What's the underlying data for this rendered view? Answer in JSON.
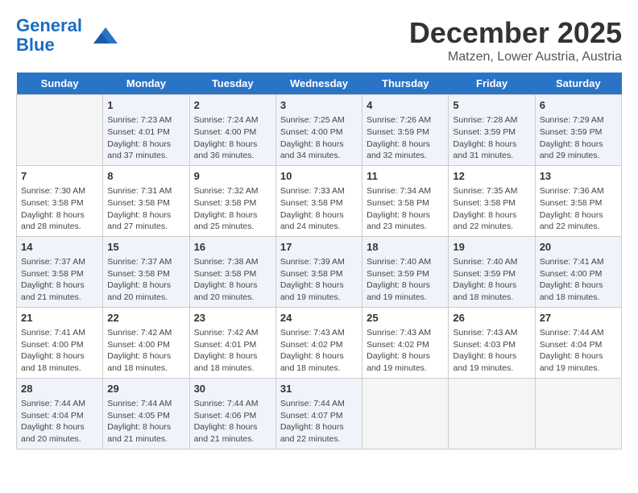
{
  "logo": {
    "line1": "General",
    "line2": "Blue"
  },
  "title": "December 2025",
  "location": "Matzen, Lower Austria, Austria",
  "days_of_week": [
    "Sunday",
    "Monday",
    "Tuesday",
    "Wednesday",
    "Thursday",
    "Friday",
    "Saturday"
  ],
  "weeks": [
    [
      {
        "day": "",
        "sunrise": "",
        "sunset": "",
        "daylight": "",
        "empty": true
      },
      {
        "day": "1",
        "sunrise": "Sunrise: 7:23 AM",
        "sunset": "Sunset: 4:01 PM",
        "daylight": "Daylight: 8 hours and 37 minutes."
      },
      {
        "day": "2",
        "sunrise": "Sunrise: 7:24 AM",
        "sunset": "Sunset: 4:00 PM",
        "daylight": "Daylight: 8 hours and 36 minutes."
      },
      {
        "day": "3",
        "sunrise": "Sunrise: 7:25 AM",
        "sunset": "Sunset: 4:00 PM",
        "daylight": "Daylight: 8 hours and 34 minutes."
      },
      {
        "day": "4",
        "sunrise": "Sunrise: 7:26 AM",
        "sunset": "Sunset: 3:59 PM",
        "daylight": "Daylight: 8 hours and 32 minutes."
      },
      {
        "day": "5",
        "sunrise": "Sunrise: 7:28 AM",
        "sunset": "Sunset: 3:59 PM",
        "daylight": "Daylight: 8 hours and 31 minutes."
      },
      {
        "day": "6",
        "sunrise": "Sunrise: 7:29 AM",
        "sunset": "Sunset: 3:59 PM",
        "daylight": "Daylight: 8 hours and 29 minutes."
      }
    ],
    [
      {
        "day": "7",
        "sunrise": "Sunrise: 7:30 AM",
        "sunset": "Sunset: 3:58 PM",
        "daylight": "Daylight: 8 hours and 28 minutes."
      },
      {
        "day": "8",
        "sunrise": "Sunrise: 7:31 AM",
        "sunset": "Sunset: 3:58 PM",
        "daylight": "Daylight: 8 hours and 27 minutes."
      },
      {
        "day": "9",
        "sunrise": "Sunrise: 7:32 AM",
        "sunset": "Sunset: 3:58 PM",
        "daylight": "Daylight: 8 hours and 25 minutes."
      },
      {
        "day": "10",
        "sunrise": "Sunrise: 7:33 AM",
        "sunset": "Sunset: 3:58 PM",
        "daylight": "Daylight: 8 hours and 24 minutes."
      },
      {
        "day": "11",
        "sunrise": "Sunrise: 7:34 AM",
        "sunset": "Sunset: 3:58 PM",
        "daylight": "Daylight: 8 hours and 23 minutes."
      },
      {
        "day": "12",
        "sunrise": "Sunrise: 7:35 AM",
        "sunset": "Sunset: 3:58 PM",
        "daylight": "Daylight: 8 hours and 22 minutes."
      },
      {
        "day": "13",
        "sunrise": "Sunrise: 7:36 AM",
        "sunset": "Sunset: 3:58 PM",
        "daylight": "Daylight: 8 hours and 22 minutes."
      }
    ],
    [
      {
        "day": "14",
        "sunrise": "Sunrise: 7:37 AM",
        "sunset": "Sunset: 3:58 PM",
        "daylight": "Daylight: 8 hours and 21 minutes."
      },
      {
        "day": "15",
        "sunrise": "Sunrise: 7:37 AM",
        "sunset": "Sunset: 3:58 PM",
        "daylight": "Daylight: 8 hours and 20 minutes."
      },
      {
        "day": "16",
        "sunrise": "Sunrise: 7:38 AM",
        "sunset": "Sunset: 3:58 PM",
        "daylight": "Daylight: 8 hours and 20 minutes."
      },
      {
        "day": "17",
        "sunrise": "Sunrise: 7:39 AM",
        "sunset": "Sunset: 3:58 PM",
        "daylight": "Daylight: 8 hours and 19 minutes."
      },
      {
        "day": "18",
        "sunrise": "Sunrise: 7:40 AM",
        "sunset": "Sunset: 3:59 PM",
        "daylight": "Daylight: 8 hours and 19 minutes."
      },
      {
        "day": "19",
        "sunrise": "Sunrise: 7:40 AM",
        "sunset": "Sunset: 3:59 PM",
        "daylight": "Daylight: 8 hours and 18 minutes."
      },
      {
        "day": "20",
        "sunrise": "Sunrise: 7:41 AM",
        "sunset": "Sunset: 4:00 PM",
        "daylight": "Daylight: 8 hours and 18 minutes."
      }
    ],
    [
      {
        "day": "21",
        "sunrise": "Sunrise: 7:41 AM",
        "sunset": "Sunset: 4:00 PM",
        "daylight": "Daylight: 8 hours and 18 minutes."
      },
      {
        "day": "22",
        "sunrise": "Sunrise: 7:42 AM",
        "sunset": "Sunset: 4:00 PM",
        "daylight": "Daylight: 8 hours and 18 minutes."
      },
      {
        "day": "23",
        "sunrise": "Sunrise: 7:42 AM",
        "sunset": "Sunset: 4:01 PM",
        "daylight": "Daylight: 8 hours and 18 minutes."
      },
      {
        "day": "24",
        "sunrise": "Sunrise: 7:43 AM",
        "sunset": "Sunset: 4:02 PM",
        "daylight": "Daylight: 8 hours and 18 minutes."
      },
      {
        "day": "25",
        "sunrise": "Sunrise: 7:43 AM",
        "sunset": "Sunset: 4:02 PM",
        "daylight": "Daylight: 8 hours and 19 minutes."
      },
      {
        "day": "26",
        "sunrise": "Sunrise: 7:43 AM",
        "sunset": "Sunset: 4:03 PM",
        "daylight": "Daylight: 8 hours and 19 minutes."
      },
      {
        "day": "27",
        "sunrise": "Sunrise: 7:44 AM",
        "sunset": "Sunset: 4:04 PM",
        "daylight": "Daylight: 8 hours and 19 minutes."
      }
    ],
    [
      {
        "day": "28",
        "sunrise": "Sunrise: 7:44 AM",
        "sunset": "Sunset: 4:04 PM",
        "daylight": "Daylight: 8 hours and 20 minutes."
      },
      {
        "day": "29",
        "sunrise": "Sunrise: 7:44 AM",
        "sunset": "Sunset: 4:05 PM",
        "daylight": "Daylight: 8 hours and 21 minutes."
      },
      {
        "day": "30",
        "sunrise": "Sunrise: 7:44 AM",
        "sunset": "Sunset: 4:06 PM",
        "daylight": "Daylight: 8 hours and 21 minutes."
      },
      {
        "day": "31",
        "sunrise": "Sunrise: 7:44 AM",
        "sunset": "Sunset: 4:07 PM",
        "daylight": "Daylight: 8 hours and 22 minutes."
      },
      {
        "day": "",
        "sunrise": "",
        "sunset": "",
        "daylight": "",
        "empty": true
      },
      {
        "day": "",
        "sunrise": "",
        "sunset": "",
        "daylight": "",
        "empty": true
      },
      {
        "day": "",
        "sunrise": "",
        "sunset": "",
        "daylight": "",
        "empty": true
      }
    ]
  ]
}
